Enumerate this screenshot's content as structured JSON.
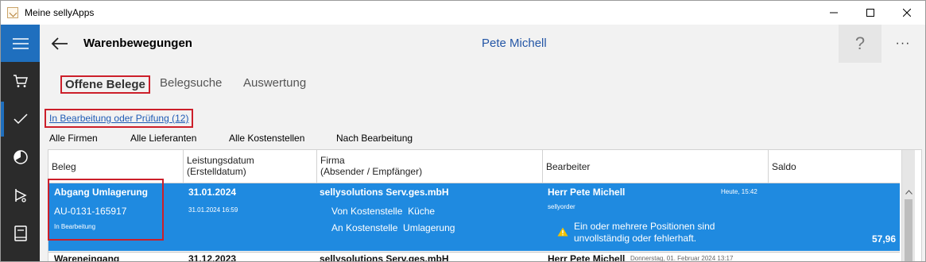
{
  "window": {
    "title": "Meine sellyApps",
    "controls": [
      "minimize",
      "maximize",
      "close"
    ]
  },
  "sidebar": {
    "items": [
      {
        "icon": "hamburger-menu-icon"
      },
      {
        "icon": "shopping-cart-icon"
      },
      {
        "icon": "checkmark-icon"
      },
      {
        "icon": "pie-chart-icon"
      },
      {
        "icon": "route-icon"
      },
      {
        "icon": "book-icon"
      }
    ]
  },
  "header": {
    "title": "Warenbewegungen",
    "user": "Pete Michell",
    "help_label": "?",
    "more_label": "···"
  },
  "tabs": [
    {
      "label": "Offene Belege",
      "active": true
    },
    {
      "label": "Belegsuche",
      "active": false
    },
    {
      "label": "Auswertung",
      "active": false
    }
  ],
  "status_link": "In Bearbeitung oder Prüfung (12)",
  "filters": [
    "Alle Firmen",
    "Alle Lieferanten",
    "Alle Kostenstellen",
    "Nach Bearbeitung"
  ],
  "table": {
    "headers": [
      {
        "line1": "Beleg",
        "line2": ""
      },
      {
        "line1": "Leistungsdatum",
        "line2": "(Erstelldatum)"
      },
      {
        "line1": "Firma",
        "line2": "(Absender / Empfänger)"
      },
      {
        "line1": "Bearbeiter",
        "line2": ""
      },
      {
        "line1": "Saldo",
        "line2": ""
      }
    ],
    "rows": [
      {
        "type": "Abgang Umlagerung",
        "number": "AU-0131-165917",
        "status": "In Bearbeitung",
        "service_date": "31.01.2024",
        "created_date": "31.01.2024 16:59",
        "company": "sellysolutions Serv.ges.mbH",
        "from": "Von Kostenstelle  Küche",
        "to": "An Kostenstelle  Umlagerung",
        "editor": "Herr Pete Michell",
        "editor_time": "Heute, 15:42",
        "editor_account": "sellyorder",
        "warning_line1": "Ein oder mehrere Positionen sind",
        "warning_line2": "unvollständig oder fehlerhaft.",
        "balance": "57,96"
      },
      {
        "type": "Wareneingang",
        "service_date": "31.12.2023",
        "company": "sellysolutions Serv.ges.mbH",
        "editor": "Herr Pete Michell",
        "editor_time": "Donnerstag, 01. Februar 2024 13:17"
      }
    ]
  },
  "colors": {
    "accent": "#1f6fbe",
    "selection": "#1f8ae0",
    "highlight": "#cc1f2a",
    "warning": "#f2c200"
  }
}
